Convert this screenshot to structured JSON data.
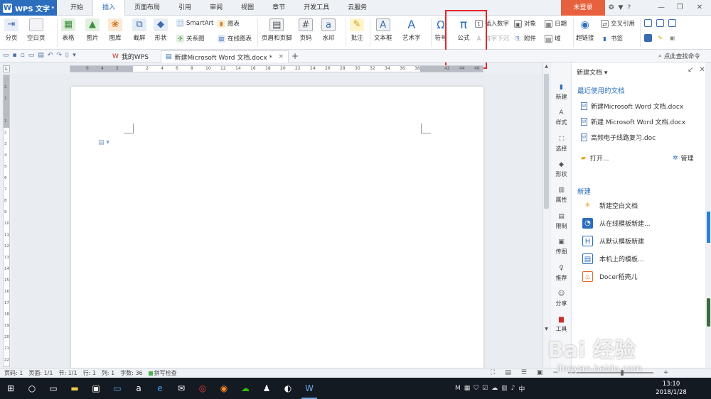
{
  "titlebar": {
    "app_name": "WPS 文字",
    "app_caret": "▾",
    "tabs": [
      "开始",
      "插入",
      "页面布局",
      "引用",
      "审阅",
      "视图",
      "章节",
      "开发工具",
      "云服务"
    ],
    "login_button": "未登录",
    "icons": [
      "skin-icon",
      "shirt-icon",
      "help-icon"
    ],
    "help_label": "?",
    "window_controls": [
      "—",
      "❐",
      "✕"
    ]
  },
  "ribbon": {
    "page_break": "分页",
    "blank_page": "空白页",
    "table": "表格",
    "picture": "图片",
    "gallery": "图库",
    "screenshot": "截屏",
    "shape": "形状",
    "smartart": "SmartArt",
    "chart": "图表",
    "relation_chart": "关系图",
    "online_chart": "在线图表",
    "header_footer": "页眉和页脚",
    "page_number": "页码",
    "watermark": "水印",
    "comment": "批注",
    "textbox": "文本框",
    "wordart": "艺术字",
    "symbol": "符号",
    "formula": "公式",
    "insert_number": "插入数字",
    "first_letter": "首字下沉",
    "object": "对象",
    "attachment": "附件",
    "date": "日期",
    "field": "域",
    "hyperlink": "超链接",
    "cross_ref": "交叉引用",
    "bookmark": "书签"
  },
  "qabar": {
    "mywps_tab": "我的WPS",
    "doc_tab": "新建Microsoft Word 文档.docx *",
    "close_x": "×",
    "add_tab": "+",
    "find_command": "点此查找命令"
  },
  "ruler": {
    "h_ticks": [
      "6",
      "4",
      "2",
      "",
      "2",
      "4",
      "6",
      "8",
      "10",
      "12",
      "14",
      "16",
      "18",
      "20",
      "22",
      "24",
      "26",
      "28",
      "30",
      "32",
      "34",
      "36",
      "38",
      "",
      "42",
      "44",
      "46"
    ],
    "v_ticks": [
      "2",
      "1",
      "",
      "1",
      "2",
      "3",
      "4",
      "5",
      "6",
      "7",
      "8",
      "9",
      "10",
      "11",
      "12",
      "13",
      "14",
      "15",
      "16",
      "17",
      "18",
      "19",
      "20",
      "21",
      "22"
    ],
    "corner": "L"
  },
  "sidebar_tabs": [
    "新建",
    "样式",
    "选择",
    "形状",
    "属性",
    "限制",
    "传图",
    "推荐",
    "分享",
    "工具"
  ],
  "panel": {
    "header": "新建文档 ▾",
    "recent_title": "最近使用的文档",
    "recent_docs": [
      "新建Microsoft Word 文档.docx",
      "新建 Microsoft Word 文档.docx",
      "高频电子线路复习.doc"
    ],
    "open_label": "打开...",
    "manage_label": "管理",
    "new_title": "新建",
    "new_items": [
      "新建空白文档",
      "从在线模板新建...",
      "从默认模板新建",
      "本机上的模板...",
      "Docer稻壳儿"
    ]
  },
  "statusbar": {
    "page": "页码: 1",
    "pages": "页面: 1/1",
    "section": "节: 1/1",
    "row": "行: 1",
    "col": "列: 1",
    "words": "字数: 36",
    "spell": "拼写检查"
  },
  "taskbar": {
    "clock_time": "13:10",
    "clock_date": "2018/1/28"
  },
  "watermark": {
    "main": "Bai 经验",
    "sub": "jingyan.baidu.com"
  },
  "colors": {
    "accent": "#2a6ebd",
    "login": "#e8613e",
    "highlight": "#e3262b",
    "taskbar": "#141a22"
  }
}
